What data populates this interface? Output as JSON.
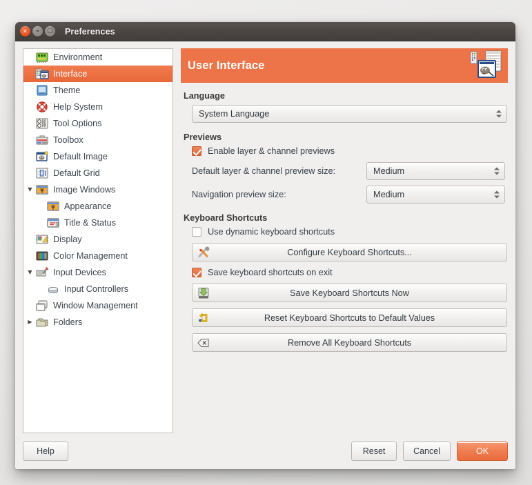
{
  "window": {
    "title": "Preferences",
    "controls": {
      "close": "×",
      "minimize": "–",
      "maximize": "□"
    }
  },
  "colors": {
    "accent": "#ec7448",
    "selection": "#e8683a",
    "titlebar": "#4a4542",
    "panel_bg": "#f0efee",
    "sidebar_bg": "#ffffff"
  },
  "sidebar": {
    "items": [
      {
        "label": "Environment",
        "icon": "environment-icon",
        "level": 0,
        "expander": "",
        "selected": false
      },
      {
        "label": "Interface",
        "icon": "interface-icon",
        "level": 0,
        "expander": "",
        "selected": true
      },
      {
        "label": "Theme",
        "icon": "theme-icon",
        "level": 0,
        "expander": "",
        "selected": false
      },
      {
        "label": "Help System",
        "icon": "help-system-icon",
        "level": 0,
        "expander": "",
        "selected": false
      },
      {
        "label": "Tool Options",
        "icon": "tool-options-icon",
        "level": 0,
        "expander": "",
        "selected": false
      },
      {
        "label": "Toolbox",
        "icon": "toolbox-icon",
        "level": 0,
        "expander": "",
        "selected": false
      },
      {
        "label": "Default Image",
        "icon": "default-image-icon",
        "level": 0,
        "expander": "",
        "selected": false
      },
      {
        "label": "Default Grid",
        "icon": "default-grid-icon",
        "level": 0,
        "expander": "",
        "selected": false
      },
      {
        "label": "Image Windows",
        "icon": "image-windows-icon",
        "level": 0,
        "expander": "▼",
        "selected": false
      },
      {
        "label": "Appearance",
        "icon": "appearance-icon",
        "level": 1,
        "expander": "",
        "selected": false
      },
      {
        "label": "Title & Status",
        "icon": "title-status-icon",
        "level": 1,
        "expander": "",
        "selected": false
      },
      {
        "label": "Display",
        "icon": "display-icon",
        "level": 0,
        "expander": "",
        "selected": false
      },
      {
        "label": "Color Management",
        "icon": "color-management-icon",
        "level": 0,
        "expander": "",
        "selected": false
      },
      {
        "label": "Input Devices",
        "icon": "input-devices-icon",
        "level": 0,
        "expander": "▼",
        "selected": false
      },
      {
        "label": "Input Controllers",
        "icon": "input-controllers-icon",
        "level": 1,
        "expander": "",
        "selected": false
      },
      {
        "label": "Window Management",
        "icon": "window-management-icon",
        "level": 0,
        "expander": "",
        "selected": false
      },
      {
        "label": "Folders",
        "icon": "folders-icon",
        "level": 0,
        "expander": "▶",
        "selected": false
      }
    ]
  },
  "main": {
    "header": {
      "title": "User Interface",
      "icon": "gimp-wilber-window-icon"
    },
    "sections": {
      "language": {
        "title": "Language",
        "combo_value": "System Language"
      },
      "previews": {
        "title": "Previews",
        "enable_previews": {
          "label": "Enable layer & channel previews",
          "checked": true
        },
        "default_preview_size": {
          "label": "Default layer & channel preview size:",
          "value": "Medium"
        },
        "navigation_preview_size": {
          "label": "Navigation preview size:",
          "value": "Medium"
        }
      },
      "keyboard_shortcuts": {
        "title": "Keyboard Shortcuts",
        "use_dynamic": {
          "label": "Use dynamic keyboard shortcuts",
          "checked": false
        },
        "configure_button": {
          "label": "Configure Keyboard Shortcuts...",
          "icon": "wrench-screwdriver-icon"
        },
        "save_on_exit": {
          "label": "Save keyboard shortcuts on exit",
          "checked": true
        },
        "save_now_button": {
          "label": "Save Keyboard Shortcuts Now",
          "icon": "save-disk-icon"
        },
        "reset_button": {
          "label": "Reset Keyboard Shortcuts to Default Values",
          "icon": "reset-arrow-icon"
        },
        "remove_all_button": {
          "label": "Remove All Keyboard Shortcuts",
          "icon": "erase-backspace-icon"
        }
      }
    }
  },
  "actions": {
    "help": "Help",
    "reset": "Reset",
    "cancel": "Cancel",
    "ok": "OK"
  }
}
